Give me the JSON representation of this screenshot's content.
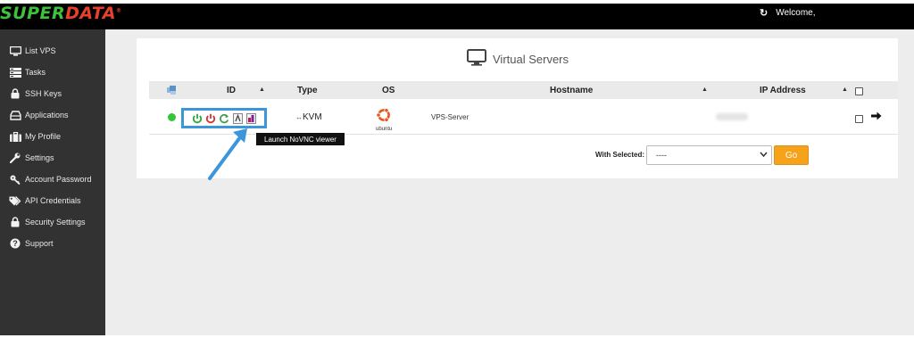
{
  "brand": {
    "part1": "SUPER",
    "part2": "DATA",
    "mark": "®"
  },
  "header": {
    "welcome": "Welcome,"
  },
  "sidebar": {
    "items": [
      {
        "label": "List VPS",
        "icon": "monitor-icon"
      },
      {
        "label": "Tasks",
        "icon": "tasks-icon"
      },
      {
        "label": "SSH Keys",
        "icon": "lock-icon"
      },
      {
        "label": "Applications",
        "icon": "drive-icon"
      },
      {
        "label": "My Profile",
        "icon": "briefcase-icon"
      },
      {
        "label": "Settings",
        "icon": "wrench-icon"
      },
      {
        "label": "Account Password",
        "icon": "key-icon"
      },
      {
        "label": "API Credentials",
        "icon": "tags-icon"
      },
      {
        "label": "Security Settings",
        "icon": "lock-icon"
      },
      {
        "label": "Support",
        "icon": "question-icon"
      }
    ]
  },
  "main": {
    "title": "Virtual Servers",
    "columns": {
      "id": "ID",
      "type": "Type",
      "os": "OS",
      "hostname": "Hostname",
      "ip": "IP Address"
    },
    "rows": [
      {
        "type": "KVM",
        "os": "ubuntu",
        "hostname": "VPS-Server",
        "status": "online"
      }
    ],
    "tooltip": "Launch NoVNC viewer",
    "with_selected_label": "With Selected:",
    "select_value": "----",
    "go_label": "Go"
  },
  "colors": {
    "brand_green": "#3ec13b",
    "brand_red": "#e8402b",
    "highlight_blue": "#3b96dc",
    "go_orange": "#f6a21a",
    "status_online": "#35c53a"
  }
}
